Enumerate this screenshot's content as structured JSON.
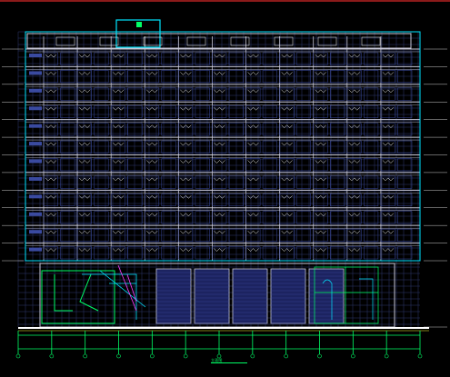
{
  "colors": {
    "background": "#000000",
    "frame_top": "#8b1a1a",
    "facade_line": "#c8c8d8",
    "grid_line": "#2e3a6e",
    "window_fill": "#1c2360",
    "window_mid": "#3a4aa0",
    "green_line": "#00ff66",
    "cyan_line": "#00e5ff",
    "magenta_line": "#ff3cff",
    "yellow_line": "#ffff33",
    "white_text": "#ffffff"
  },
  "drawing": {
    "title": "立面图",
    "floors": 12,
    "window_bays": 22,
    "axis_count": 12
  }
}
